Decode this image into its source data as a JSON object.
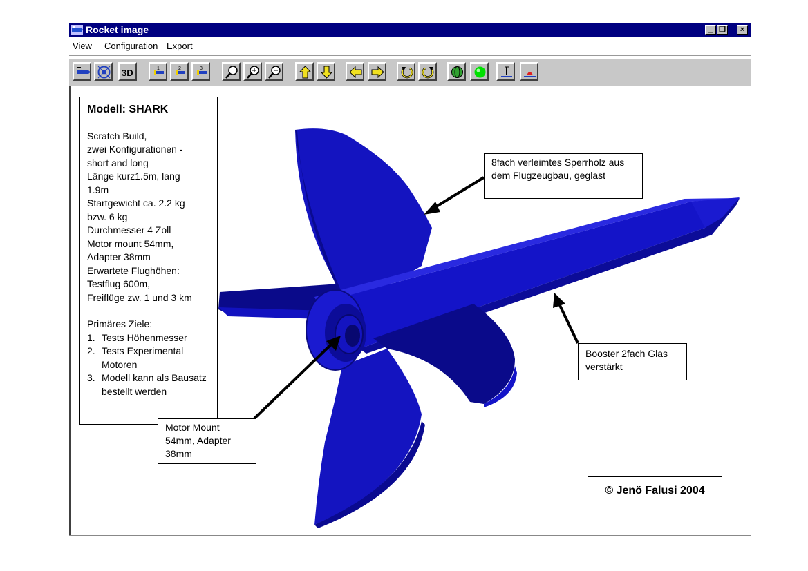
{
  "window": {
    "title": "Rocket image",
    "controls": {
      "minimize": "_",
      "restore": "❐",
      "close": "×"
    }
  },
  "menu": [
    {
      "label": "View",
      "accel": "V"
    },
    {
      "label": "Configuration",
      "accel": "C"
    },
    {
      "label": "Export",
      "accel": "E"
    }
  ],
  "toolbar": {
    "buttons": [
      "side-view-icon",
      "front-view-icon",
      "3d-view-icon",
      "config-1-icon",
      "config-2-icon",
      "config-3-icon",
      "zoom-icon",
      "zoom-in-icon",
      "zoom-out-icon",
      "move-up-icon",
      "move-down-icon",
      "move-left-icon",
      "move-right-icon",
      "rotate-left-icon",
      "rotate-right-icon",
      "globe-icon",
      "green-light-icon",
      "measure-icon",
      "launch-pad-icon"
    ],
    "three_d_label": "3D"
  },
  "colors": {
    "rocket_blue": "#1010c8",
    "rocket_dark": "#080878",
    "titlebar": "#000080"
  },
  "info": {
    "title": "Modell: SHARK",
    "lines": [
      "Scratch Build,",
      "zwei Konfigurationen -",
      "short and long",
      "Länge kurz1.5m, lang",
      "1.9m",
      "Startgewicht ca. 2.2 kg",
      "bzw. 6 kg",
      "Durchmesser 4 Zoll",
      "Motor mount 54mm,",
      "Adapter 38mm",
      "Erwartete Flughöhen:",
      "Testflug 600m,",
      "Freiflüge zw. 1 und 3 km"
    ],
    "goals_title": "Primäres Ziele:",
    "goals": [
      {
        "num": "1.",
        "text": "Tests Höhenmesser"
      },
      {
        "num": "2.",
        "text": "Tests Experimental Motoren"
      },
      {
        "num": "3.",
        "text": "Modell kann als Bausatz bestellt werden"
      }
    ]
  },
  "callouts": {
    "fin": "8fach verleimtes Sperrholz aus dem Flugzeugbau, geglast",
    "booster": "Booster 2fach Glas verstärkt",
    "motor": "Motor Mount 54mm, Adapter 38mm"
  },
  "copyright": "© Jenö Falusi 2004"
}
